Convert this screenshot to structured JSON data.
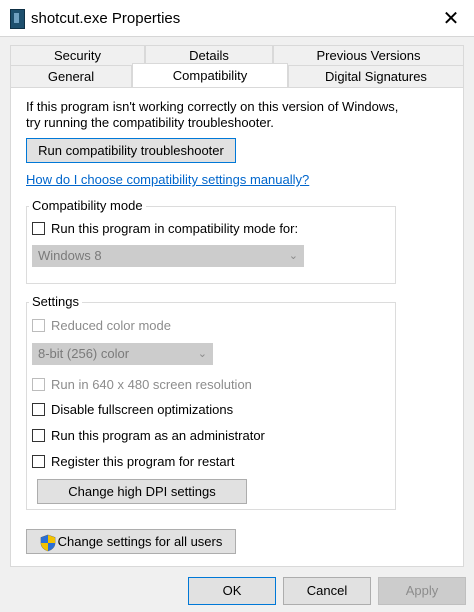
{
  "window": {
    "title": "shotcut.exe Properties",
    "close_glyph": "✕"
  },
  "tabs": {
    "row1": [
      "Security",
      "Details",
      "Previous Versions"
    ],
    "row2": [
      "General",
      "Compatibility",
      "Digital Signatures"
    ],
    "active": "Compatibility"
  },
  "compat": {
    "intro_line1": "If this program isn't working correctly on this version of Windows,",
    "intro_line2": "try running the compatibility troubleshooter.",
    "troubleshooter_button": "Run compatibility troubleshooter",
    "help_link": "How do I choose compatibility settings manually?",
    "mode_group": {
      "title": "Compatibility mode",
      "checkbox_label": "Run this program in compatibility mode for:",
      "checked": false,
      "select_value": "Windows 8"
    },
    "settings_group": {
      "title": "Settings",
      "reduced_color": {
        "label": "Reduced color mode",
        "checked": false,
        "enabled": false
      },
      "color_select_value": "8-bit (256) color",
      "res_640": {
        "label": "Run in 640 x 480 screen resolution",
        "checked": false,
        "enabled": false
      },
      "disable_fullscreen": {
        "label": "Disable fullscreen optimizations",
        "checked": false
      },
      "run_as_admin": {
        "label": "Run this program as an administrator",
        "checked": false
      },
      "register_restart": {
        "label": "Register this program for restart",
        "checked": false
      },
      "dpi_button": "Change high DPI settings"
    },
    "all_users_button": "Change settings for all users"
  },
  "footer": {
    "ok": "OK",
    "cancel": "Cancel",
    "apply": "Apply"
  },
  "colors": {
    "accent": "#0078d7",
    "link": "#0066cc",
    "disabled_text": "#8c8c8c"
  }
}
